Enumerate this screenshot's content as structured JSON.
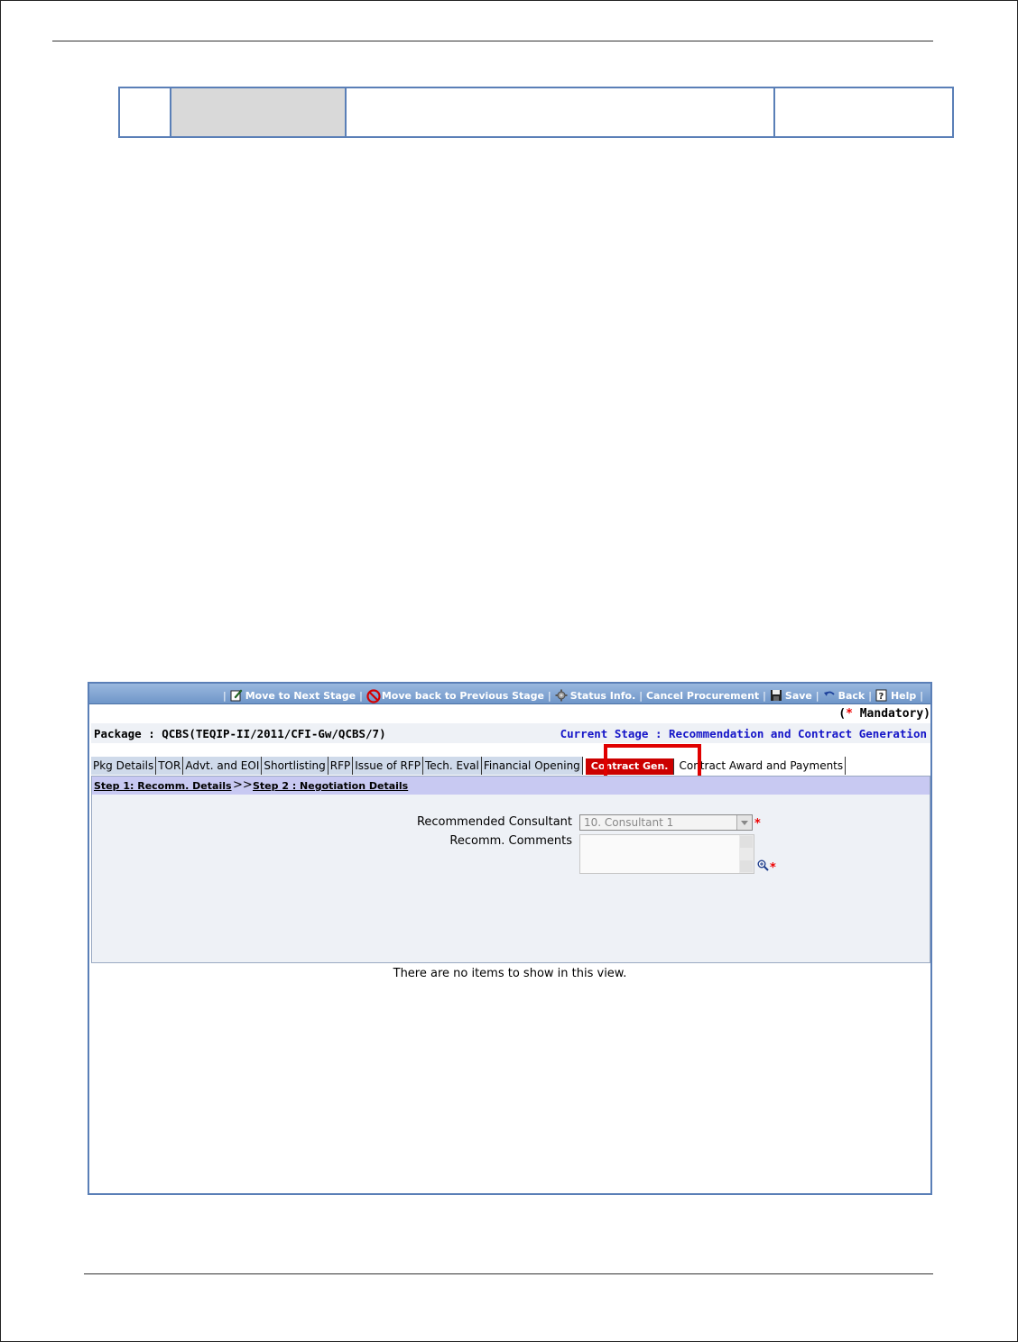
{
  "toolbar": {
    "move_next": "Move to Next Stage",
    "move_back": "Move back to Previous Stage",
    "status_info": "Status Info.",
    "cancel_procurement": "Cancel Procurement",
    "save": "Save",
    "back": "Back",
    "help": "Help",
    "separator": "|"
  },
  "mandatory": {
    "open": "(",
    "star": "*",
    "label": " Mandatory)"
  },
  "package": {
    "label": "Package : QCBS(TEQIP-II/2011/CFI-Gw/QCBS/7)",
    "current_stage": "Current Stage : Recommendation and Contract Generation"
  },
  "tabs": [
    {
      "label": "Pkg Details"
    },
    {
      "label": "TOR"
    },
    {
      "label": "Advt. and EOI"
    },
    {
      "label": "Shortlisting"
    },
    {
      "label": "RFP"
    },
    {
      "label": "Issue of RFP"
    },
    {
      "label": "Tech. Eval"
    },
    {
      "label": "Financial Opening"
    },
    {
      "label": "Contract Gen."
    },
    {
      "label": "Contract Award and Payments"
    }
  ],
  "steps": {
    "step1": "Step 1: Recomm. Details",
    "arrow": ">>",
    "step2": "Step 2 : Negotiation Details"
  },
  "form": {
    "recommended_consultant_label": "Recommended Consultant",
    "recommended_consultant_value": "10. Consultant 1",
    "comments_label": "Recomm. Comments",
    "required_marker": "*"
  },
  "empty_message": "There are no items to show in this view.",
  "colors": {
    "toolbar": "#7fa3d2",
    "active_tab": "#cc0000",
    "highlight": "#e00000",
    "stage_text": "#1414c8"
  }
}
